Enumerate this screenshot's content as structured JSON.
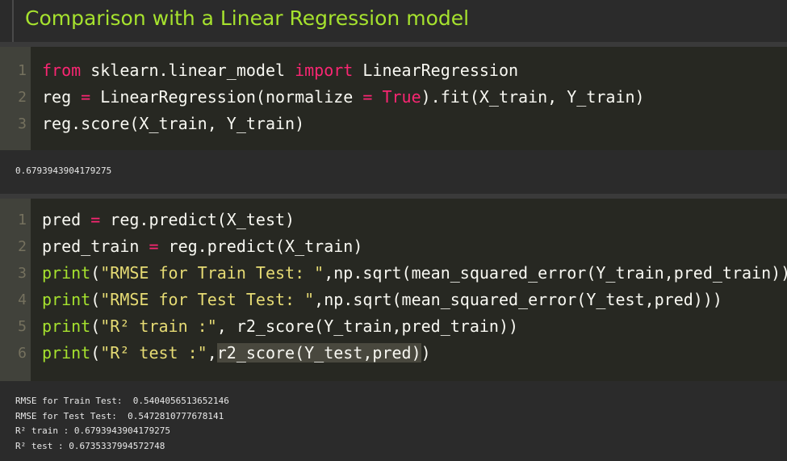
{
  "heading": {
    "title": "Comparison with a Linear Regression model"
  },
  "cell1": {
    "lines": [
      {
        "n": "1",
        "t": [
          {
            "c": "kw",
            "v": "from"
          },
          {
            "c": "",
            "v": " sklearn.linear_model "
          },
          {
            "c": "kw",
            "v": "import"
          },
          {
            "c": "",
            "v": " LinearRegression"
          }
        ]
      },
      {
        "n": "2",
        "t": [
          {
            "c": "",
            "v": "reg "
          },
          {
            "c": "op",
            "v": "="
          },
          {
            "c": "",
            "v": " LinearRegression(normalize "
          },
          {
            "c": "op",
            "v": "="
          },
          {
            "c": "",
            "v": " "
          },
          {
            "c": "const",
            "v": "True"
          },
          {
            "c": "",
            "v": ").fit(X_train, Y_train)"
          }
        ]
      },
      {
        "n": "3",
        "t": [
          {
            "c": "",
            "v": "reg.score(X_train, Y_train)"
          }
        ]
      }
    ],
    "output": [
      "0.6793943904179275"
    ]
  },
  "cell2": {
    "lines": [
      {
        "n": "1",
        "t": [
          {
            "c": "",
            "v": "pred "
          },
          {
            "c": "op",
            "v": "="
          },
          {
            "c": "",
            "v": " reg.predict(X_test)"
          }
        ]
      },
      {
        "n": "2",
        "t": [
          {
            "c": "",
            "v": "pred_train "
          },
          {
            "c": "op",
            "v": "="
          },
          {
            "c": "",
            "v": " reg.predict(X_train)"
          }
        ]
      },
      {
        "n": "3",
        "t": [
          {
            "c": "bi",
            "v": "print"
          },
          {
            "c": "",
            "v": "("
          },
          {
            "c": "str",
            "v": "\"RMSE for Train Test: \""
          },
          {
            "c": "",
            "v": ",np.sqrt(mean_squared_error(Y_train,pred_train)))"
          }
        ]
      },
      {
        "n": "4",
        "t": [
          {
            "c": "bi",
            "v": "print"
          },
          {
            "c": "",
            "v": "("
          },
          {
            "c": "str",
            "v": "\"RMSE for Test Test: \""
          },
          {
            "c": "",
            "v": ",np.sqrt(mean_squared_error(Y_test,pred)))"
          }
        ]
      },
      {
        "n": "5",
        "t": [
          {
            "c": "bi",
            "v": "print"
          },
          {
            "c": "",
            "v": "("
          },
          {
            "c": "str",
            "v": "\"R² train :\""
          },
          {
            "c": "",
            "v": ", r2_score(Y_train,pred_train))"
          }
        ]
      },
      {
        "n": "6",
        "t": [
          {
            "c": "bi",
            "v": "print"
          },
          {
            "c": "",
            "v": "("
          },
          {
            "c": "str",
            "v": "\"R² test :\""
          },
          {
            "c": "",
            "v": ","
          },
          {
            "c": "hl",
            "v": "r2_score(Y_test,pred)"
          },
          {
            "c": "",
            "v": ")"
          }
        ]
      }
    ],
    "output": [
      "RMSE for Train Test:  0.5404056513652146",
      "RMSE for Test Test:  0.5472810777678141",
      "R² train : 0.6793943904179275",
      "R² test : 0.6735337994572748"
    ]
  },
  "colors": {
    "keyword": "#f92672",
    "builtin": "#a6e22e",
    "string": "#e6db74",
    "heading": "#a6e22e",
    "editor_bg": "#272822",
    "gutter_bg": "#41423b"
  }
}
